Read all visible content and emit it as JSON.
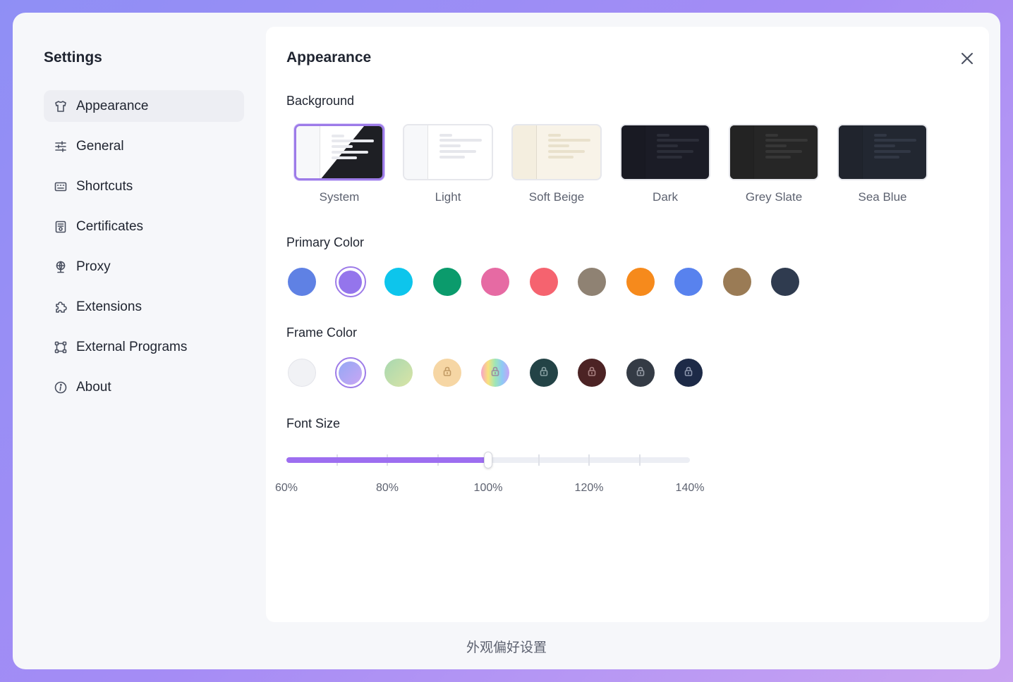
{
  "sidebar": {
    "title": "Settings",
    "items": [
      {
        "label": "Appearance",
        "icon": "shirt-icon",
        "active": true
      },
      {
        "label": "General",
        "icon": "sliders-icon",
        "active": false
      },
      {
        "label": "Shortcuts",
        "icon": "keyboard-icon",
        "active": false
      },
      {
        "label": "Certificates",
        "icon": "certificate-icon",
        "active": false
      },
      {
        "label": "Proxy",
        "icon": "globe-icon",
        "active": false
      },
      {
        "label": "Extensions",
        "icon": "puzzle-icon",
        "active": false
      },
      {
        "label": "External Programs",
        "icon": "nodes-icon",
        "active": false
      },
      {
        "label": "About",
        "icon": "info-icon",
        "active": false
      }
    ]
  },
  "panel": {
    "title": "Appearance",
    "background": {
      "label": "Background",
      "options": [
        {
          "label": "System",
          "selected": true,
          "base": "#ffffff",
          "side": "#f7f8fa",
          "line": "#e8e9ee",
          "dark": "#1e1f24"
        },
        {
          "label": "Light",
          "selected": false,
          "base": "#ffffff",
          "side": "#f7f8fa",
          "line": "#e6e7ec"
        },
        {
          "label": "Soft Beige",
          "selected": false,
          "base": "#f8f3e8",
          "side": "#f4eedf",
          "line": "#e9e1cc"
        },
        {
          "label": "Dark",
          "selected": false,
          "base": "#1b1c26",
          "side": "#191a23",
          "line": "#2b2d38"
        },
        {
          "label": "Grey Slate",
          "selected": false,
          "base": "#262626",
          "side": "#232323",
          "line": "#363636"
        },
        {
          "label": "Sea Blue",
          "selected": false,
          "base": "#222731",
          "side": "#20242d",
          "line": "#313744"
        }
      ]
    },
    "primary_color": {
      "label": "Primary Color",
      "colors": [
        "#5f81e4",
        "#9475ec",
        "#0dc5ec",
        "#0b9b6c",
        "#e66aa3",
        "#f5636f",
        "#8f8273",
        "#f68a1c",
        "#5882ee",
        "#9a7b55",
        "#2f3b4f"
      ],
      "selected_index": 1
    },
    "frame_color": {
      "label": "Frame Color",
      "swatches": [
        {
          "fill": "#f1f2f5",
          "locked": false,
          "lock_color": ""
        },
        {
          "fill": "linear-gradient(135deg,#94a8f5,#c9a6f3)",
          "locked": false,
          "lock_color": ""
        },
        {
          "fill": "linear-gradient(135deg,#a8d8b0,#d9e4a6)",
          "locked": false,
          "lock_color": ""
        },
        {
          "fill": "#f6d6a4",
          "locked": true,
          "lock_color": "#c29a64"
        },
        {
          "fill": "linear-gradient(90deg,#f7a3c9,#f8e27c,#9ee6b7,#8ec9f5,#c6a4f4)",
          "locked": true,
          "lock_color": "#9a8aa0"
        },
        {
          "fill": "#234346",
          "locked": true,
          "lock_color": "#8aa1a3"
        },
        {
          "fill": "#4c2324",
          "locked": true,
          "lock_color": "#a88282"
        },
        {
          "fill": "#343b45",
          "locked": true,
          "lock_color": "#959ba5"
        },
        {
          "fill": "#1d2a47",
          "locked": true,
          "lock_color": "#8c96ad"
        }
      ],
      "selected_index": 1
    },
    "font_size": {
      "label": "Font Size",
      "value_percent": 100,
      "min": 60,
      "max": 140,
      "tick_labels": [
        "60%",
        "80%",
        "100%",
        "120%",
        "140%"
      ]
    }
  },
  "caption": "外观偏好设置"
}
